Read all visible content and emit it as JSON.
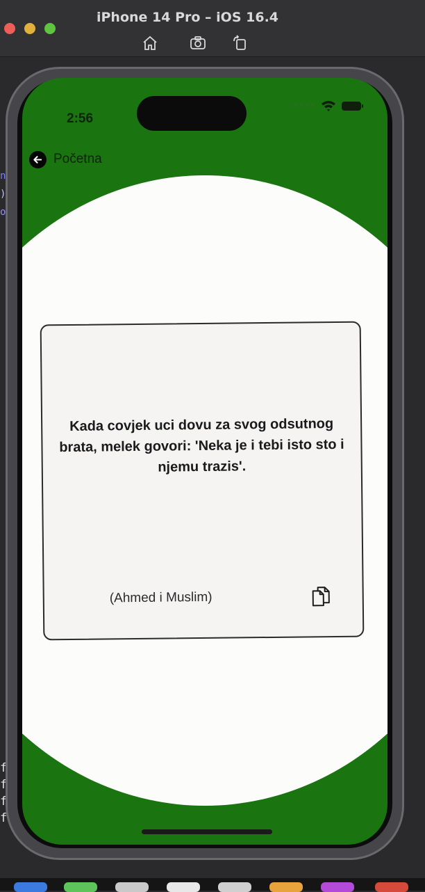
{
  "simulator": {
    "title": "iPhone 14 Pro – iOS 16.4",
    "buttons": [
      "home-icon",
      "screenshot-icon",
      "rotate-icon"
    ]
  },
  "status_bar": {
    "time": "2:56"
  },
  "nav": {
    "back_label": "Početna"
  },
  "quote": {
    "text": "Kada covjek uci dovu za svog odsutnog brata, melek govori: 'Neka je i tebi isto sto i njemu trazis'.",
    "source": "(Ahmed i Muslim)",
    "copy_icon": "copy-icon"
  },
  "background_code": {
    "lines": [
      "fi",
      "fi",
      "fi",
      "fi"
    ]
  },
  "colors": {
    "accent_green": "#1a7410",
    "card_background": "#f5f4f3",
    "screen_white": "#fcfcfb"
  }
}
